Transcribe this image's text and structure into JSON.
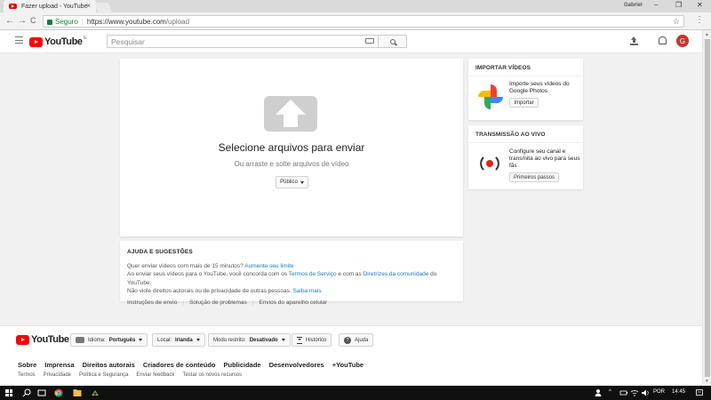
{
  "browser": {
    "tab_title": "Fazer upload - YouTube",
    "tab_close": "×",
    "user_label": "Gabriel",
    "window_controls": [
      "–",
      "❐",
      "✕"
    ],
    "back": "←",
    "forward": "→",
    "reload": "C",
    "secure_label": "Seguro",
    "url_scheme_host": "https://www.youtube.com",
    "url_path": "/upload",
    "star": "☆",
    "menu": "⋮"
  },
  "header": {
    "logo_text": "YouTube",
    "logo_country": "IE",
    "search_placeholder": "Pesquisar",
    "avatar_letter": "G"
  },
  "upload": {
    "title": "Selecione arquivos para enviar",
    "subtitle": "Ou arraste e solte arquivos de vídeo",
    "privacy": "Público"
  },
  "help": {
    "title": "AJUDA E SUGESTÕES",
    "line1_text": "Quer enviar vídeos com mais de 15 minutos?",
    "line1_link": "Aumente seu limite",
    "line2_a": "Ao enviar seus vídeos para o YouTube, você concorda com os",
    "line2_link1": "Termos de Serviço",
    "line2_b": "e com as",
    "line2_link2": "Diretrizes da comunidade",
    "line2_c": "do YouTube.",
    "line3_text": "Não viole direitos autorais ou de privacidade de outras pessoas.",
    "line3_link": "Saiba mais",
    "links": [
      "Instruções de envio",
      "Solução de problemas",
      "Envios do aparelho celular"
    ],
    "divider": "|"
  },
  "import_card": {
    "title": "IMPORTAR VÍDEOS",
    "text": "Importe seus vídeos do Google Photos",
    "button": "Importar"
  },
  "live_card": {
    "title": "TRANSMISSÃO AO VIVO",
    "text": "Configure seu canal e transmita ao vivo para seus fãs",
    "button": "Primeiros passos"
  },
  "footer": {
    "logo_text": "YouTube",
    "language_label": "Idioma:",
    "language_value": "Português",
    "location_label": "Local:",
    "location_value": "Irlanda",
    "restricted_label": "Modo restrito:",
    "restricted_value": "Desativado",
    "history": "Histórico",
    "help": "Ajuda",
    "help_glyph": "?",
    "links": [
      "Sobre",
      "Imprensa",
      "Direitos autorais",
      "Criadores de conteúdo",
      "Publicidade",
      "Desenvolvedores",
      "+YouTube"
    ],
    "small_links": [
      "Termos",
      "Privacidade",
      "Política e Segurança",
      "Enviar feedback",
      "Testar os novos recursos"
    ]
  },
  "taskbar": {
    "lang": "POR",
    "time": "14:45"
  }
}
